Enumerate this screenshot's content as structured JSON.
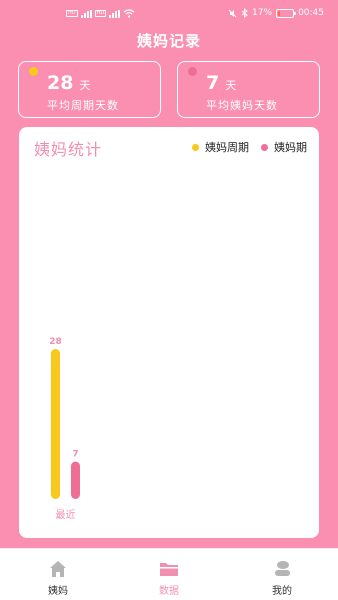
{
  "status_bar": {
    "sim_tags": [
      "HD",
      "HD"
    ],
    "battery_percent": "17%",
    "battery_level": 0.17,
    "time": "00:45"
  },
  "header": {
    "title": "姨妈记录"
  },
  "stats": [
    {
      "value": "28",
      "unit": "天",
      "label": "平均周期天数",
      "dot_color": "#f8c81c"
    },
    {
      "value": "7",
      "unit": "天",
      "label": "平均姨妈天数",
      "dot_color": "#f06e96"
    }
  ],
  "chart": {
    "title": "姨妈统计",
    "legend": [
      {
        "label": "姨妈周期",
        "color": "#f8c81c"
      },
      {
        "label": "姨妈期",
        "color": "#f06e96"
      }
    ]
  },
  "chart_data": {
    "type": "bar",
    "categories": [
      "最近"
    ],
    "series": [
      {
        "name": "姨妈周期",
        "values": [
          28
        ],
        "color": "#f8c81c"
      },
      {
        "name": "姨妈期",
        "values": [
          7
        ],
        "color": "#f06e96"
      }
    ],
    "data_labels": [
      "28",
      "7"
    ],
    "colors": {
      "label_color": "#f090b0"
    }
  },
  "nav": {
    "items": [
      {
        "label": "姨妈",
        "icon": "home-icon",
        "active": false
      },
      {
        "label": "数据",
        "icon": "folder-icon",
        "active": true
      },
      {
        "label": "我的",
        "icon": "profile-icon",
        "active": false
      }
    ]
  },
  "colors": {
    "primary": "#fa8fb1",
    "accent": "#f090b0"
  }
}
